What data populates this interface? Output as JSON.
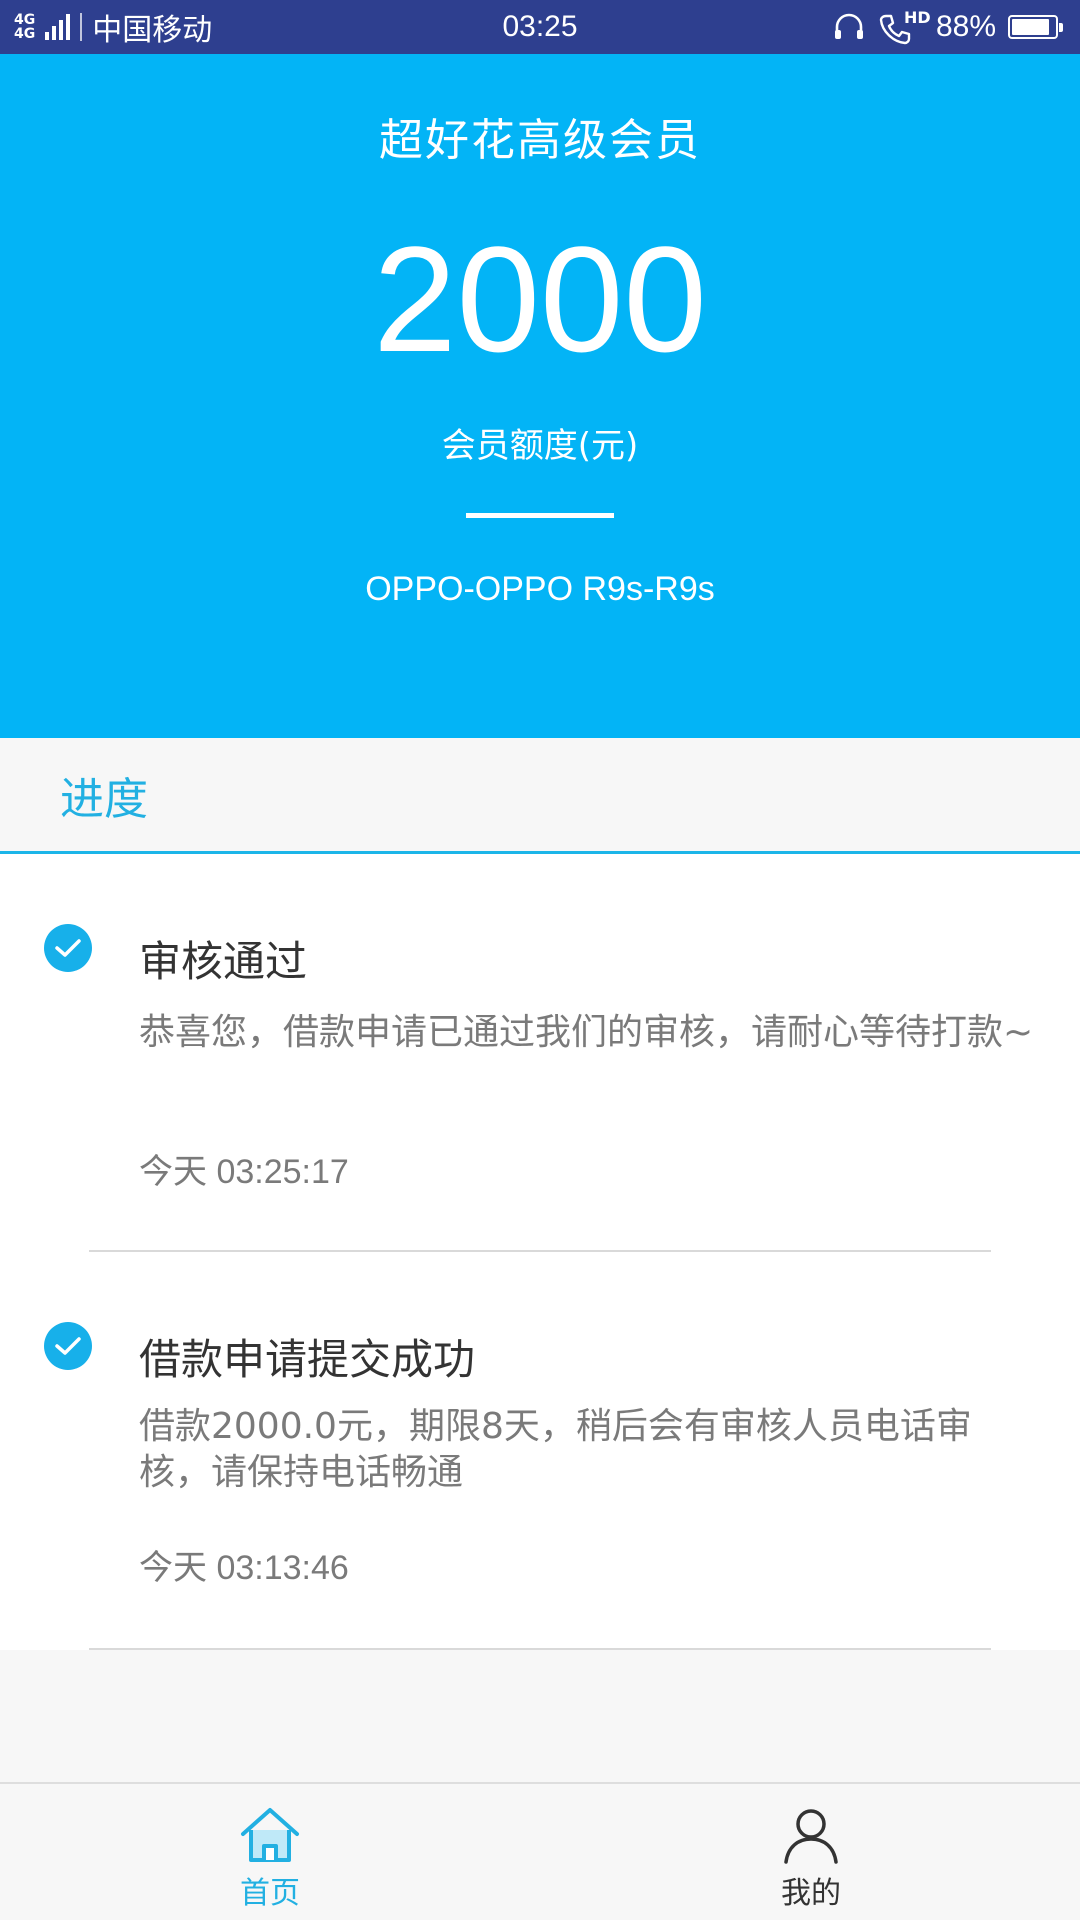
{
  "status_bar": {
    "network_top": "4G",
    "network_top2": "4G",
    "carrier": "中国移动",
    "time": "03:25",
    "hd": "HD",
    "battery": "88%",
    "battery_level": 0.88,
    "icons": [
      "signal-icon",
      "headset-icon",
      "hd-call-icon",
      "battery-icon"
    ]
  },
  "hero": {
    "title": "超好花高级会员",
    "amount": "2000",
    "amount_label": "会员额度(元)",
    "device": "OPPO-OPPO R9s-R9s",
    "background": "#03b4f6"
  },
  "section": {
    "title": "进度",
    "accent": "#22b0e2"
  },
  "progress": [
    {
      "title": "审核通过",
      "desc": "恭喜您，借款申请已通过我们的审核，请耐心等待打款~",
      "time": "今天 03:25:17",
      "icon": "check-circle-icon"
    },
    {
      "title": "借款申请提交成功",
      "desc": "借款2000.0元，期限8天，稍后会有审核人员电话审核，请保持电话畅通",
      "time": "今天 03:13:46",
      "icon": "check-circle-icon"
    }
  ],
  "nav": {
    "home_label": "首页",
    "mine_label": "我的",
    "home_icon": "home-icon",
    "mine_icon": "user-icon",
    "active_color": "#22b0e2"
  }
}
